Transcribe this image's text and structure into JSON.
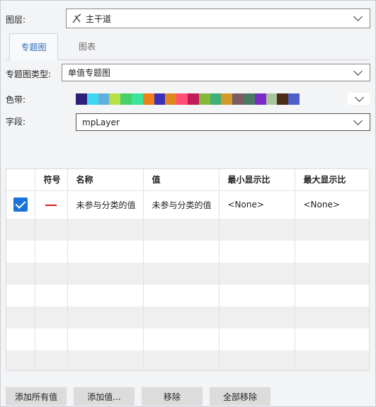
{
  "layer": {
    "label": "图层:",
    "value": "主干道",
    "icon": "line-layer-icon"
  },
  "tabs": {
    "thematic": "专题图",
    "chart": "图表"
  },
  "thematic_type": {
    "label": "专题图类型:",
    "value": "单值专题图"
  },
  "color_band": {
    "label": "色带:",
    "colors": [
      "#2e1f7c",
      "#3fd6f0",
      "#5fb0e0",
      "#b6e043",
      "#46d06a",
      "#3be39b",
      "#f07f1a",
      "#3b2fb8",
      "#e0861f",
      "#ff4f72",
      "#c01b5a",
      "#86b83b",
      "#3fb07a",
      "#d29a2a",
      "#7a5c62",
      "#4a7a63",
      "#7b2bc9",
      "#a9c39c",
      "#4a2c1a",
      "#4e5fc8"
    ]
  },
  "field": {
    "label": "字段:",
    "value": "mpLayer"
  },
  "table": {
    "headers": [
      "",
      "符号",
      "名称",
      "值",
      "最小显示比",
      "最大显示比"
    ],
    "rows": [
      {
        "checked": true,
        "symbol_color": "#d81b1b",
        "name": "未参与分类的值",
        "value": "未参与分类的值",
        "min_scale": "<None>",
        "max_scale": "<None>"
      }
    ]
  },
  "buttons": {
    "add_all": "添加所有值",
    "add_value": "添加值...",
    "remove": "移除",
    "remove_all": "全部移除"
  }
}
